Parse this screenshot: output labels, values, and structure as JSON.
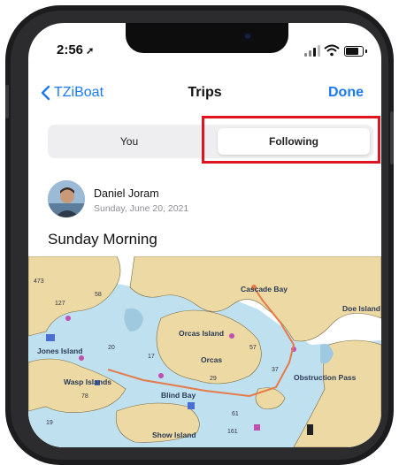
{
  "status_bar": {
    "time": "2:56",
    "location_arrow": "➚"
  },
  "nav": {
    "back_label": "TZiBoat",
    "title": "Trips",
    "done_label": "Done"
  },
  "segments": {
    "you": "You",
    "following": "Following",
    "selected": "Following"
  },
  "author": {
    "name": "Daniel Joram",
    "date": "Sunday, June 20, 2021"
  },
  "trip": {
    "title": "Sunday Morning"
  },
  "map": {
    "labels": [
      "Cascade Bay",
      "Orcas Island",
      "Orcas",
      "Doe Island",
      "Show Island",
      "Jones Island",
      "Obstruction Pass",
      "Wasp Islands",
      "Blind Bay"
    ],
    "depth_soundings": [
      "473",
      "127",
      "58",
      "29",
      "17",
      "20",
      "57",
      "61",
      "78",
      "37",
      "19",
      "161"
    ]
  },
  "colors": {
    "accent": "#1a7bf1",
    "highlight": "#e0141e",
    "land": "#ecd9a4",
    "shallow_water": "#bfe0ef",
    "deep_water": "#ffffff",
    "track": "#e67b4a"
  },
  "icons": [
    "back-chevron-icon",
    "location-arrow-icon",
    "cellular-signal-icon",
    "wifi-icon",
    "battery-icon"
  ]
}
